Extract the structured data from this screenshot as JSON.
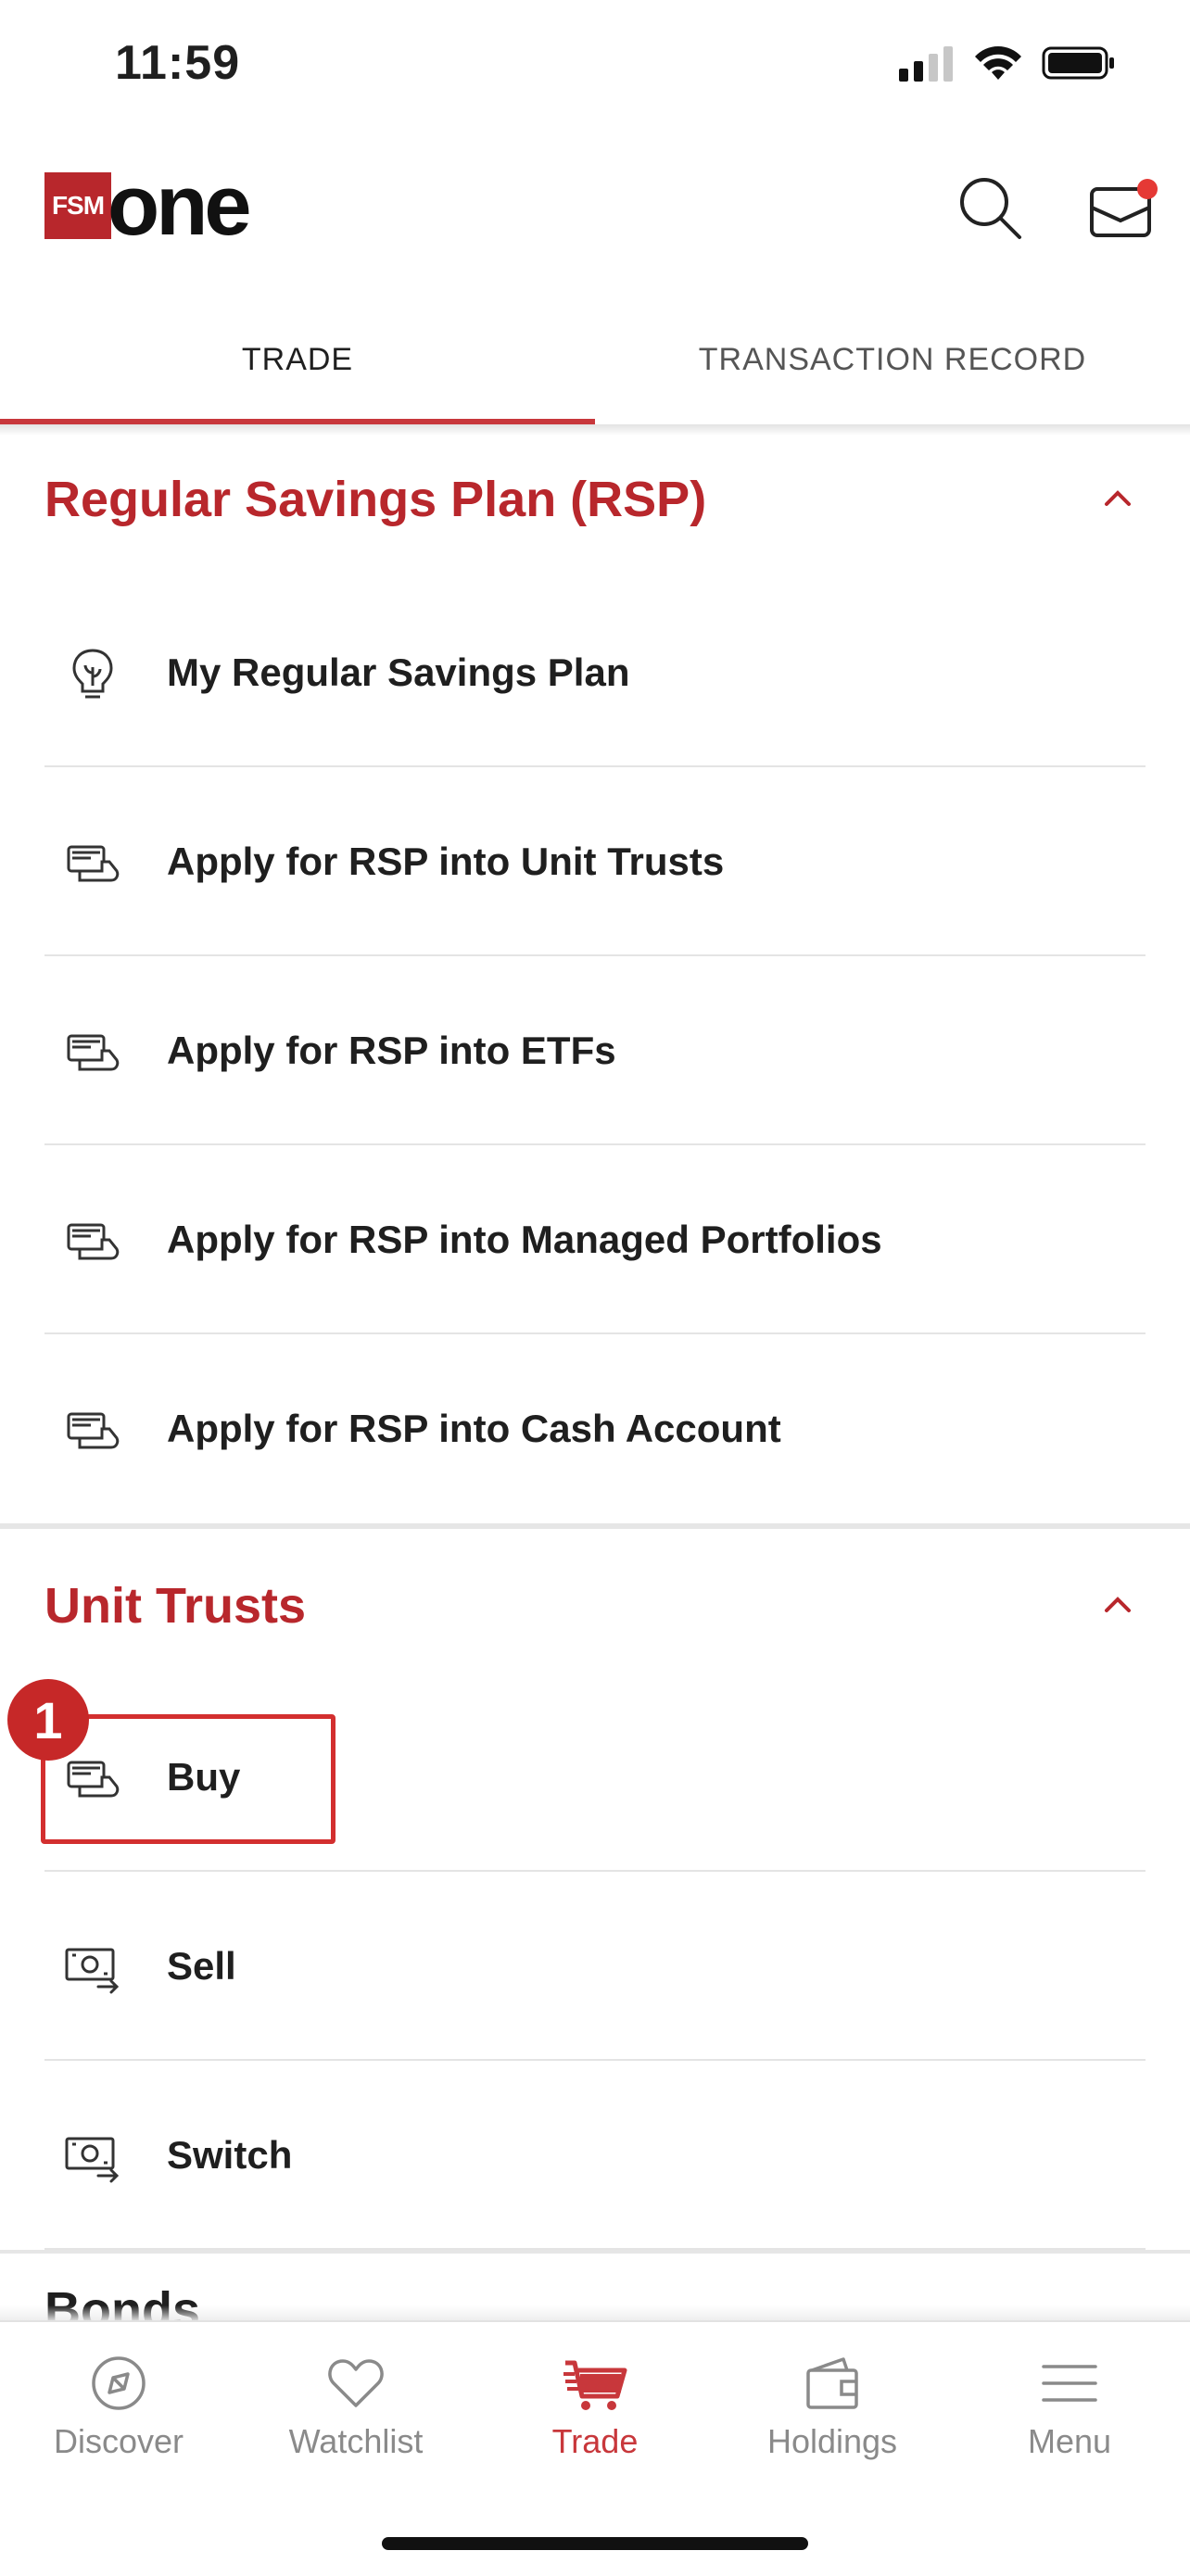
{
  "status_bar": {
    "time": "11:59"
  },
  "header": {
    "logo_badge": "FSM",
    "logo_word": "one"
  },
  "tabs": [
    {
      "label": "TRADE",
      "active": true
    },
    {
      "label": "TRANSACTION RECORD",
      "active": false
    }
  ],
  "sections": {
    "rsp": {
      "title": "Regular Savings Plan (RSP)",
      "items": [
        {
          "label": "My Regular Savings Plan",
          "icon": "lightbulb-icon"
        },
        {
          "label": "Apply for RSP into Unit Trusts",
          "icon": "cash-hand-icon"
        },
        {
          "label": "Apply for RSP into ETFs",
          "icon": "cash-hand-icon"
        },
        {
          "label": "Apply for RSP into Managed Portfolios",
          "icon": "cash-hand-icon"
        },
        {
          "label": "Apply for RSP into Cash Account",
          "icon": "cash-hand-icon"
        }
      ]
    },
    "unit_trusts": {
      "title": "Unit Trusts",
      "items": [
        {
          "label": "Buy",
          "icon": "cash-hand-icon"
        },
        {
          "label": "Sell",
          "icon": "money-transfer-icon"
        },
        {
          "label": "Switch",
          "icon": "money-transfer-icon"
        }
      ]
    },
    "next_section_peek": "Bonds"
  },
  "annotation": {
    "step_number": "1"
  },
  "bottom_nav": [
    {
      "label": "Discover",
      "icon": "compass-icon"
    },
    {
      "label": "Watchlist",
      "icon": "heart-icon"
    },
    {
      "label": "Trade",
      "icon": "cart-icon",
      "active": true
    },
    {
      "label": "Holdings",
      "icon": "wallet-icon"
    },
    {
      "label": "Menu",
      "icon": "hamburger-icon"
    }
  ],
  "colors": {
    "accent": "#b8272c",
    "text": "#1f1f1f",
    "muted": "#8a8a8a",
    "highlight": "#d32f2f"
  }
}
